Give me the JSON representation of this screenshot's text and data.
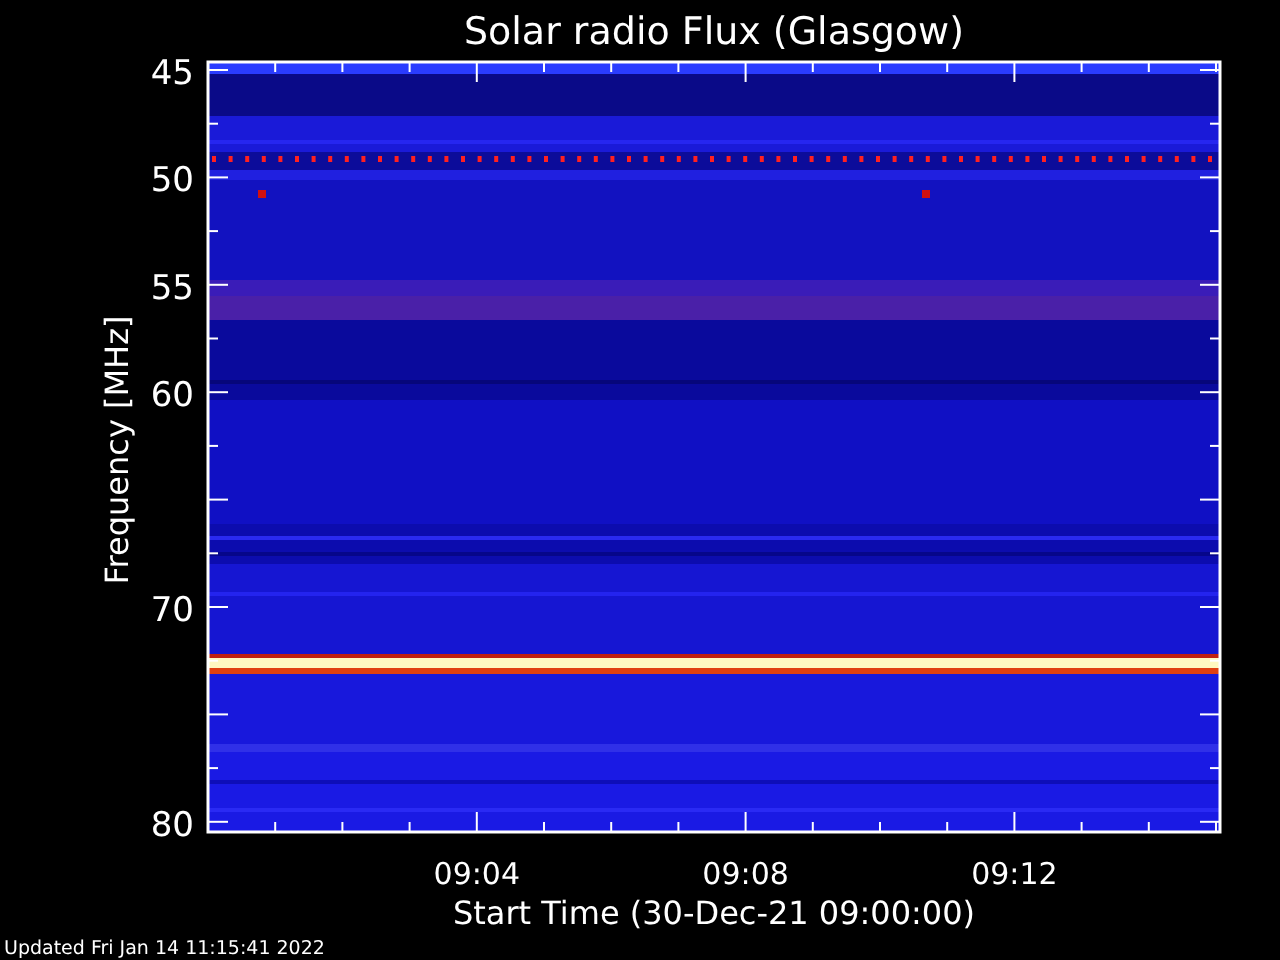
{
  "title": "Solar radio Flux (Glasgow)",
  "y_axis": {
    "label": "Frequency [MHz]",
    "ticks": [
      "45",
      "50",
      "55",
      "60",
      "70",
      "80"
    ]
  },
  "x_axis": {
    "label": "Start Time (30-Dec-21 09:00:00)",
    "ticks": [
      "09:04",
      "09:08",
      "09:12"
    ]
  },
  "footer": "Updated Fri Jan 14 11:15:41 2022"
}
